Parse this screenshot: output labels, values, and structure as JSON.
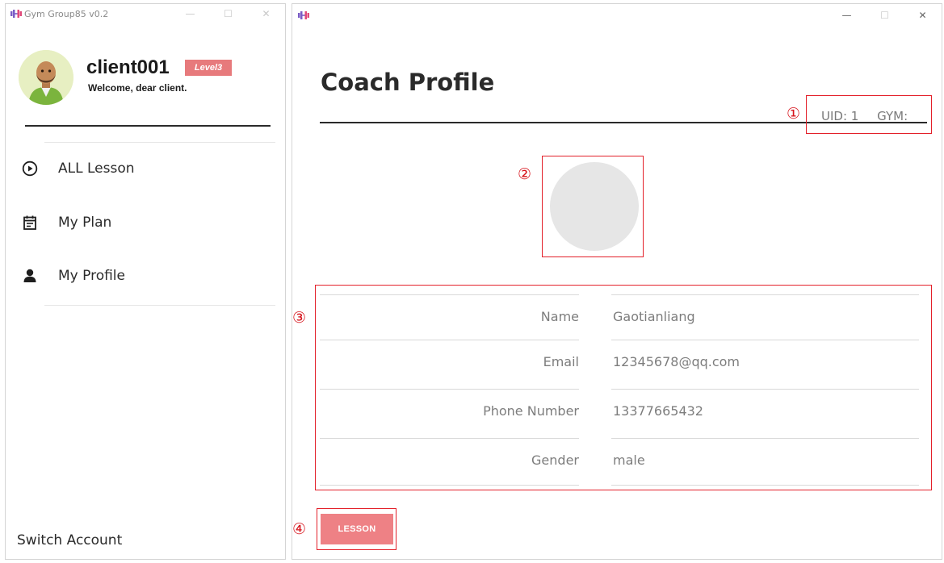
{
  "left_window": {
    "title": "Gym Group85 v0.2",
    "controls": {
      "minimize": "—",
      "maximize": "☐",
      "close": "✕"
    },
    "user": {
      "username": "client001",
      "level": "Level3",
      "welcome": "Welcome, dear client."
    },
    "nav": [
      {
        "label": "ALL Lesson",
        "icon": "play-circle-icon"
      },
      {
        "label": "My Plan",
        "icon": "calendar-icon"
      },
      {
        "label": "My Profile",
        "icon": "person-icon"
      }
    ],
    "switch_account": "Switch Account"
  },
  "right_window": {
    "controls": {
      "minimize": "—",
      "maximize": "☐",
      "close": "✕"
    },
    "title": "Coach Profile",
    "uid_label": "UID: 1",
    "gym_label": "GYM:",
    "fields": [
      {
        "label": "Name",
        "value": "Gaotianliang"
      },
      {
        "label": "Email",
        "value": "12345678@qq.com"
      },
      {
        "label": "Phone Number",
        "value": "13377665432"
      },
      {
        "label": "Gender",
        "value": "male"
      }
    ],
    "lesson_button": "LESSON"
  },
  "annotations": [
    "①",
    "②",
    "③",
    "④"
  ],
  "colors": {
    "accent": "#e77a7c",
    "button": "#ee8185",
    "annotation": "#e3202a",
    "app_icon": "#7a5cc6"
  }
}
